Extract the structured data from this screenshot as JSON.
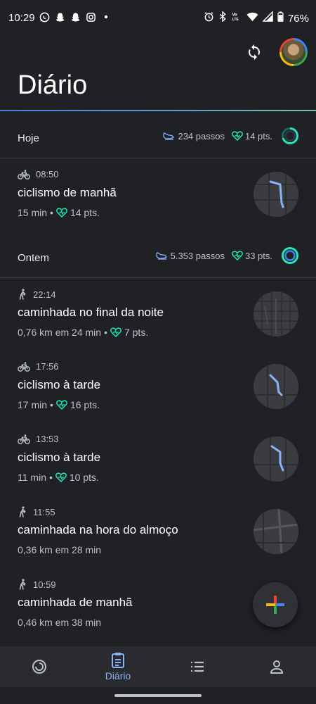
{
  "status_bar": {
    "time": "10:29",
    "battery": "76%",
    "icons": [
      "whatsapp-icon",
      "snapchat-icon",
      "snapchat-icon",
      "instagram-icon",
      "dot-icon"
    ],
    "right_icons": [
      "alarm-icon",
      "bluetooth-icon",
      "volte-icon",
      "wifi-icon",
      "signal-icon",
      "battery-icon"
    ]
  },
  "header": {
    "title": "Diário"
  },
  "days": [
    {
      "label": "Hoje",
      "steps": "234 passos",
      "points": "14 pts."
    },
    {
      "label": "Ontem",
      "steps": "5.353 passos",
      "points": "33 pts."
    }
  ],
  "activities": [
    {
      "type": "bike",
      "time": "08:50",
      "title": "ciclismo de manhã",
      "duration": "15 min",
      "sep": "•",
      "points": "14 pts."
    },
    {
      "type": "walk",
      "time": "22:14",
      "title": "caminhada no final da noite",
      "duration": "0,76 km em 24 min",
      "sep": "•",
      "points": "7 pts."
    },
    {
      "type": "bike",
      "time": "17:56",
      "title": "ciclismo à tarde",
      "duration": "17 min",
      "sep": "•",
      "points": "16 pts."
    },
    {
      "type": "bike",
      "time": "13:53",
      "title": "ciclismo à tarde",
      "duration": "11 min",
      "sep": "•",
      "points": "10 pts."
    },
    {
      "type": "walk",
      "time": "11:55",
      "title": "caminhada na hora do almoço",
      "duration": "0,36 km em 28 min"
    },
    {
      "type": "walk",
      "time": "10:59",
      "title": "caminhada de manhã",
      "duration": "0,46 km em 38 min"
    }
  ],
  "bottom_nav": {
    "active_label": "Diário",
    "items": [
      "home-icon",
      "journal-icon",
      "browse-icon",
      "profile-icon"
    ]
  },
  "colors": {
    "background": "#202124",
    "accent_blue": "#8ab4f8",
    "heart_teal": "#1de9b6",
    "steps_blue": "#7baaf7"
  }
}
